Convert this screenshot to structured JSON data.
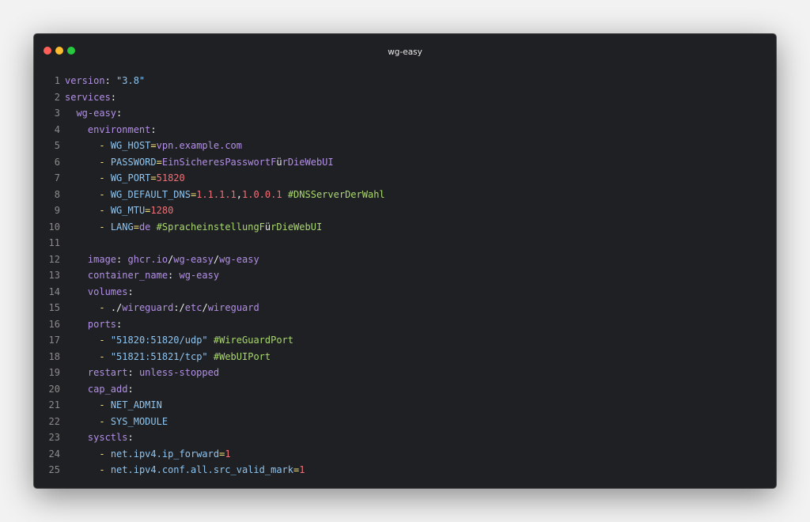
{
  "window": {
    "title": "wg-easy",
    "colors": {
      "close": "#ff5f57",
      "minimize": "#febc2e",
      "zoom": "#28c840",
      "background": "#1f2023"
    }
  },
  "code": {
    "lines": [
      {
        "num": "1",
        "tokens": [
          {
            "t": "version",
            "c": "k"
          },
          {
            "t": ": ",
            "c": "p"
          },
          {
            "t": "\"3.8\"",
            "c": "s"
          }
        ]
      },
      {
        "num": "2",
        "tokens": [
          {
            "t": "services",
            "c": "k"
          },
          {
            "t": ":",
            "c": "p"
          }
        ]
      },
      {
        "num": "3",
        "tokens": [
          {
            "t": "  wg-easy",
            "c": "k"
          },
          {
            "t": ":",
            "c": "p"
          }
        ]
      },
      {
        "num": "4",
        "tokens": [
          {
            "t": "    environment",
            "c": "k"
          },
          {
            "t": ":",
            "c": "p"
          }
        ]
      },
      {
        "num": "5",
        "tokens": [
          {
            "t": "      ",
            "c": "p"
          },
          {
            "t": "-",
            "c": "d"
          },
          {
            "t": " WG_HOST",
            "c": "s"
          },
          {
            "t": "=",
            "c": "d"
          },
          {
            "t": "vpn.example.com",
            "c": "k"
          }
        ]
      },
      {
        "num": "6",
        "tokens": [
          {
            "t": "      ",
            "c": "p"
          },
          {
            "t": "-",
            "c": "d"
          },
          {
            "t": " PASSWORD",
            "c": "s"
          },
          {
            "t": "=",
            "c": "d"
          },
          {
            "t": "EinSicheresPasswortF",
            "c": "k"
          },
          {
            "t": "ü",
            "c": "w"
          },
          {
            "t": "rDieWebUI",
            "c": "k"
          }
        ]
      },
      {
        "num": "7",
        "tokens": [
          {
            "t": "      ",
            "c": "p"
          },
          {
            "t": "-",
            "c": "d"
          },
          {
            "t": " WG_PORT",
            "c": "s"
          },
          {
            "t": "=",
            "c": "d"
          },
          {
            "t": "51820",
            "c": "n"
          }
        ]
      },
      {
        "num": "8",
        "tokens": [
          {
            "t": "      ",
            "c": "p"
          },
          {
            "t": "-",
            "c": "d"
          },
          {
            "t": " WG_DEFAULT_DNS",
            "c": "s"
          },
          {
            "t": "=",
            "c": "d"
          },
          {
            "t": "1.1.1.1",
            "c": "n"
          },
          {
            "t": ",",
            "c": "p"
          },
          {
            "t": "1.0.0.1",
            "c": "n"
          },
          {
            "t": " #DNSServerDerWahl",
            "c": "c"
          }
        ]
      },
      {
        "num": "9",
        "tokens": [
          {
            "t": "      ",
            "c": "p"
          },
          {
            "t": "-",
            "c": "d"
          },
          {
            "t": " WG_MTU",
            "c": "s"
          },
          {
            "t": "=",
            "c": "d"
          },
          {
            "t": "1280",
            "c": "n"
          }
        ]
      },
      {
        "num": "10",
        "tokens": [
          {
            "t": "      ",
            "c": "p"
          },
          {
            "t": "-",
            "c": "d"
          },
          {
            "t": " LANG",
            "c": "s"
          },
          {
            "t": "=",
            "c": "d"
          },
          {
            "t": "de",
            "c": "k"
          },
          {
            "t": " #SpracheinstellungF",
            "c": "c"
          },
          {
            "t": "ü",
            "c": "w"
          },
          {
            "t": "rDieWebUI",
            "c": "c"
          }
        ]
      },
      {
        "num": "11",
        "tokens": []
      },
      {
        "num": "12",
        "tokens": [
          {
            "t": "    image",
            "c": "k"
          },
          {
            "t": ": ",
            "c": "p"
          },
          {
            "t": "ghcr.io",
            "c": "k"
          },
          {
            "t": "/",
            "c": "p"
          },
          {
            "t": "wg-easy",
            "c": "k"
          },
          {
            "t": "/",
            "c": "p"
          },
          {
            "t": "wg-easy",
            "c": "k"
          }
        ]
      },
      {
        "num": "13",
        "tokens": [
          {
            "t": "    container_name",
            "c": "k"
          },
          {
            "t": ": ",
            "c": "p"
          },
          {
            "t": "wg-easy",
            "c": "k"
          }
        ]
      },
      {
        "num": "14",
        "tokens": [
          {
            "t": "    volumes",
            "c": "k"
          },
          {
            "t": ":",
            "c": "p"
          }
        ]
      },
      {
        "num": "15",
        "tokens": [
          {
            "t": "      ",
            "c": "p"
          },
          {
            "t": "-",
            "c": "d"
          },
          {
            "t": " .",
            "c": "p"
          },
          {
            "t": "/",
            "c": "p"
          },
          {
            "t": "wireguard",
            "c": "k"
          },
          {
            "t": ":",
            "c": "p"
          },
          {
            "t": "/",
            "c": "p"
          },
          {
            "t": "etc",
            "c": "k"
          },
          {
            "t": "/",
            "c": "p"
          },
          {
            "t": "wireguard",
            "c": "k"
          }
        ]
      },
      {
        "num": "16",
        "tokens": [
          {
            "t": "    ports",
            "c": "k"
          },
          {
            "t": ":",
            "c": "p"
          }
        ]
      },
      {
        "num": "17",
        "tokens": [
          {
            "t": "      ",
            "c": "p"
          },
          {
            "t": "-",
            "c": "d"
          },
          {
            "t": " \"51820:51820/udp\"",
            "c": "s"
          },
          {
            "t": " #WireGuardPort",
            "c": "c"
          }
        ]
      },
      {
        "num": "18",
        "tokens": [
          {
            "t": "      ",
            "c": "p"
          },
          {
            "t": "-",
            "c": "d"
          },
          {
            "t": " \"51821:51821/tcp\"",
            "c": "s"
          },
          {
            "t": " #WebUIPort",
            "c": "c"
          }
        ]
      },
      {
        "num": "19",
        "tokens": [
          {
            "t": "    restart",
            "c": "k"
          },
          {
            "t": ": ",
            "c": "p"
          },
          {
            "t": "unless-stopped",
            "c": "k"
          }
        ]
      },
      {
        "num": "20",
        "tokens": [
          {
            "t": "    cap_add",
            "c": "k"
          },
          {
            "t": ":",
            "c": "p"
          }
        ]
      },
      {
        "num": "21",
        "tokens": [
          {
            "t": "      ",
            "c": "p"
          },
          {
            "t": "-",
            "c": "d"
          },
          {
            "t": " NET_ADMIN",
            "c": "s"
          }
        ]
      },
      {
        "num": "22",
        "tokens": [
          {
            "t": "      ",
            "c": "p"
          },
          {
            "t": "-",
            "c": "d"
          },
          {
            "t": " SYS_MODULE",
            "c": "s"
          }
        ]
      },
      {
        "num": "23",
        "tokens": [
          {
            "t": "    sysctls",
            "c": "k"
          },
          {
            "t": ":",
            "c": "p"
          }
        ]
      },
      {
        "num": "24",
        "tokens": [
          {
            "t": "      ",
            "c": "p"
          },
          {
            "t": "-",
            "c": "d"
          },
          {
            "t": " net.ipv4.ip_forward",
            "c": "s"
          },
          {
            "t": "=",
            "c": "d"
          },
          {
            "t": "1",
            "c": "n"
          }
        ]
      },
      {
        "num": "25",
        "tokens": [
          {
            "t": "      ",
            "c": "p"
          },
          {
            "t": "-",
            "c": "d"
          },
          {
            "t": " net.ipv4.conf.all.src_valid_mark",
            "c": "s"
          },
          {
            "t": "=",
            "c": "d"
          },
          {
            "t": "1",
            "c": "n"
          }
        ]
      }
    ]
  }
}
